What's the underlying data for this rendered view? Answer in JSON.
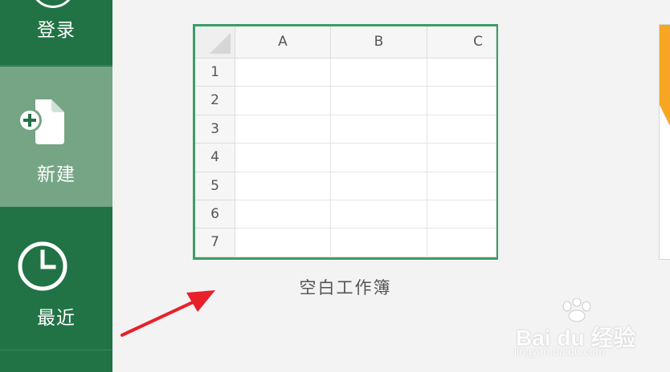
{
  "sidebar": {
    "login_label": "登录",
    "new_label": "新建",
    "recent_label": "最近",
    "colors": {
      "background": "#217346",
      "selected": "#75a585"
    }
  },
  "template": {
    "name": "空白工作簿",
    "columns": [
      "A",
      "B",
      "C"
    ],
    "rows": [
      "1",
      "2",
      "3",
      "4",
      "5",
      "6",
      "7"
    ],
    "border_color": "#3a9d67"
  },
  "next_template": {
    "accent_color": "#f6a623"
  },
  "annotation": {
    "arrow_color": "#e8202a"
  },
  "watermark": {
    "main": "Bai du 经验",
    "sub": "jingyan.baidu.com"
  }
}
